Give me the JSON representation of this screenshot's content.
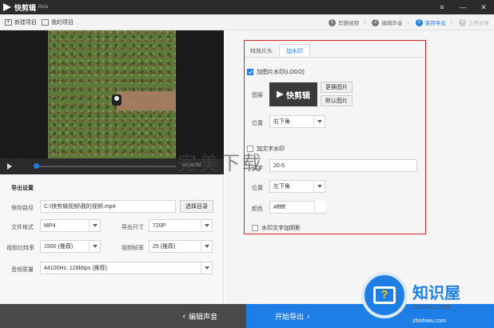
{
  "app": {
    "title": "快剪辑",
    "beta": "Beta"
  },
  "toolbar": {
    "new_project": "新建项目",
    "my_projects": "我的项目"
  },
  "steps": [
    {
      "num": "1",
      "label": "剪辑视频"
    },
    {
      "num": "2",
      "label": "编辑声音"
    },
    {
      "num": "3",
      "label": "保存导出"
    },
    {
      "num": "4",
      "label": "上传分享"
    }
  ],
  "player": {
    "time": "00:00:02"
  },
  "export": {
    "title": "导出设置",
    "save_path_label": "保存路径",
    "save_path_value": "C:\\快剪辑视频\\我的视频.mp4",
    "choose_dir": "选择目录",
    "format_label": "文件格式",
    "format_value": "MP4",
    "size_label": "导出尺寸",
    "size_value": "720P",
    "bitrate_label": "视频比特率",
    "bitrate_value": "1500 (推荐)",
    "framerate_label": "视频帧率",
    "framerate_value": "25 (推荐)",
    "audio_label": "音频质量",
    "audio_value": "44100Hz, 128kbps (推荐)"
  },
  "watermark": {
    "tab_effects": "特效片头",
    "tab_watermark": "加水印",
    "image_check_label": "加图片水印(LOGO)",
    "image_label": "图案",
    "logo_text": "快剪辑",
    "replace_image": "更换图片",
    "default_image": "默认图片",
    "position_label": "位置",
    "position_value": "右下角",
    "text_check_label": "加文字水印",
    "text_label": "文字",
    "text_value": "20-5",
    "text_position_label": "位置",
    "text_position_value": "左下角",
    "color_label": "颜色",
    "color_value": "#ffffff",
    "shadow_label": "水印文字加阴影"
  },
  "bottom": {
    "back": "编辑声音",
    "start": "开始导出"
  },
  "overlays": {
    "wanmei": "完美下载",
    "badge_name": "知识屋",
    "badge_url": "zhishiwu.com",
    "footer": "zhishiwu.com"
  },
  "colors": {
    "accent": "#1e7ee6",
    "highlight_border": "#e02020"
  }
}
